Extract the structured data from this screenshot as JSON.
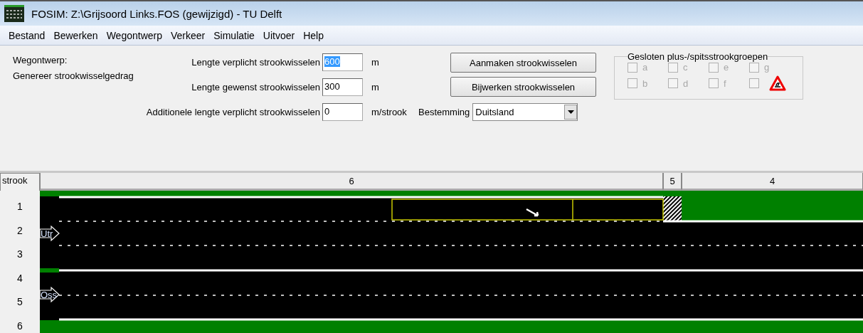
{
  "window": {
    "title": "FOSIM: Z:\\Grijsoord Links.FOS (gewijzigd) - TU Delft"
  },
  "menu": [
    "Bestand",
    "Bewerken",
    "Wegontwerp",
    "Verkeer",
    "Simulatie",
    "Uitvoer",
    "Help"
  ],
  "wegontwerp": {
    "heading": "Wegontwerp:",
    "subheading": "Genereer strookwisselgedrag",
    "fields": [
      {
        "label": "Lengte verplicht strookwisselen",
        "value": "600",
        "unit": "m",
        "text_selected": true
      },
      {
        "label": "Lengte gewenst strookwisselen",
        "value": "300",
        "unit": "m",
        "text_selected": false
      },
      {
        "label": "Additionele lengte verplicht strookwisselen",
        "value": "0",
        "unit": "m/strook",
        "text_selected": false
      }
    ],
    "buttons": [
      "Aanmaken strookwisselen",
      "Bijwerken strookwisselen"
    ],
    "destination": {
      "label": "Bestemming",
      "value": "Duitsland"
    },
    "lane_groups": {
      "title": "Gesloten plus-/spitsstrookgroepen",
      "items": [
        {
          "label": "a",
          "checked": false,
          "disabled": true
        },
        {
          "label": "c",
          "checked": false,
          "disabled": true
        },
        {
          "label": "e",
          "checked": false,
          "disabled": true
        },
        {
          "label": "g",
          "checked": false,
          "disabled": true
        },
        {
          "label": "b",
          "checked": false,
          "disabled": true
        },
        {
          "label": "d",
          "checked": false,
          "disabled": true
        },
        {
          "label": "f",
          "checked": false,
          "disabled": true
        },
        {
          "checked": false,
          "disabled": true
        }
      ]
    }
  },
  "road": {
    "lane_header": "strook",
    "segments": [
      "6",
      "5",
      "4"
    ],
    "lanes": [
      "1",
      "2",
      "3",
      "4",
      "5",
      "6"
    ],
    "origins": [
      {
        "label": "Utr"
      },
      {
        "label": "Oss"
      }
    ]
  }
}
